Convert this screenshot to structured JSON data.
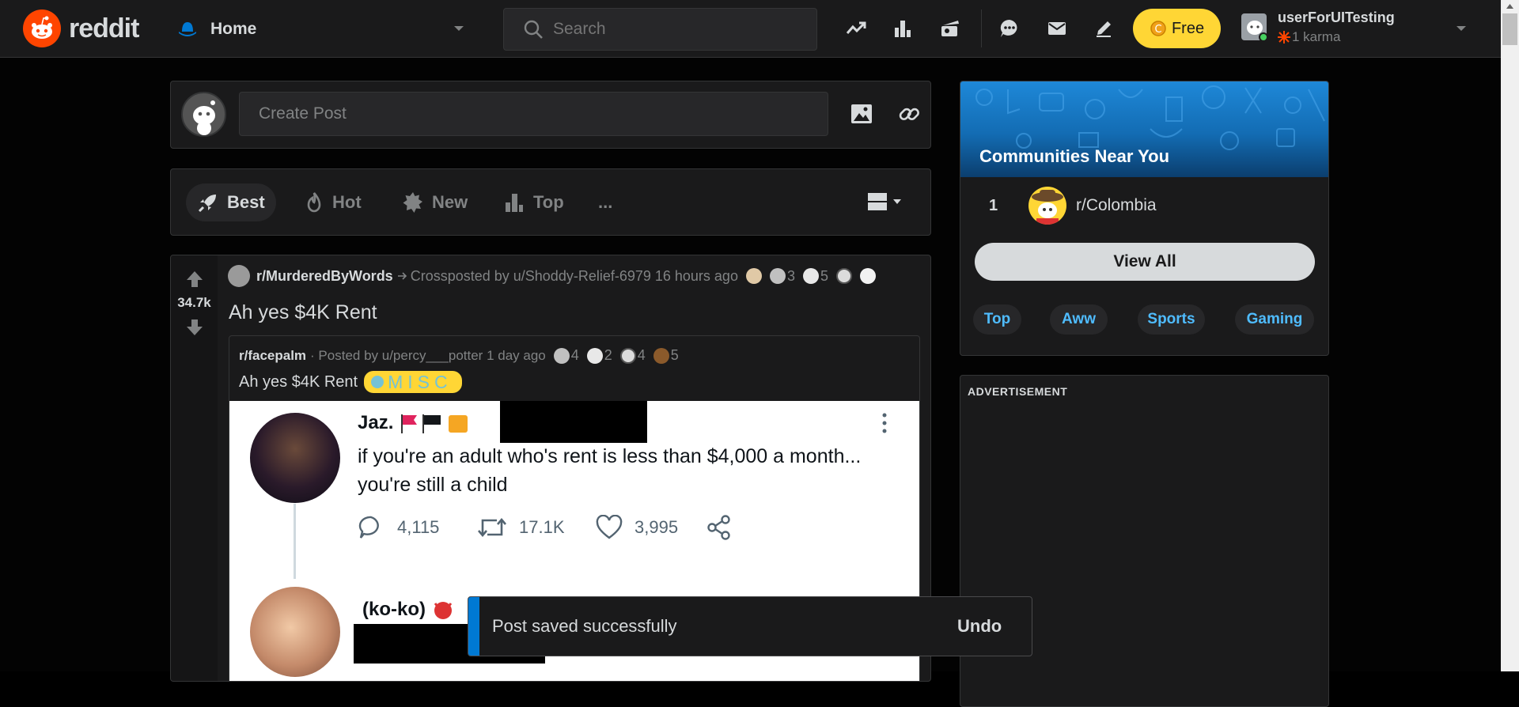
{
  "header": {
    "logo_text": "reddit",
    "home_label": "Home",
    "search_placeholder": "Search",
    "premium_label": "Free",
    "username": "userForUITesting",
    "karma": "1 karma"
  },
  "create_post": {
    "placeholder": "Create Post"
  },
  "sort": {
    "best": "Best",
    "hot": "Hot",
    "new": "New",
    "top": "Top",
    "more": "..."
  },
  "post": {
    "votes": "34.7k",
    "subreddit": "r/MurderedByWords",
    "crosspost_text": "Crossposted by u/Shoddy-Relief-6979 16 hours ago",
    "awards": [
      {
        "icon": "award-wink-icon",
        "count": ""
      },
      {
        "icon": "award-silver-icon",
        "count": "3"
      },
      {
        "icon": "award-face-icon",
        "count": "5"
      },
      {
        "icon": "award-s-icon",
        "count": ""
      },
      {
        "icon": "award-cat-icon",
        "count": ""
      }
    ],
    "title": "Ah yes $4K Rent",
    "inner": {
      "subreddit": "r/facepalm",
      "posted_text": "· Posted by u/percy___potter 1 day ago",
      "awards": [
        {
          "icon": "award-silver-icon",
          "count": "4"
        },
        {
          "icon": "award-face-icon",
          "count": "2"
        },
        {
          "icon": "award-s-icon",
          "count": "4"
        },
        {
          "icon": "award-poop-icon",
          "count": "5"
        }
      ],
      "title": "Ah yes $4K Rent",
      "flair": "MISC",
      "tweet": {
        "name": "Jaz.",
        "text": "if you're an adult who's rent is less than $4,000 a month... you're still a child",
        "replies": "4,115",
        "retweets": "17.1K",
        "likes": "3,995",
        "reply_name": "(ko-ko)"
      }
    }
  },
  "sidebar": {
    "communities_title": "Communities Near You",
    "rank": "1",
    "community": "r/Colombia",
    "view_all": "View All",
    "tags": [
      "Top",
      "Aww",
      "Sports",
      "Gaming"
    ],
    "ad_label": "ADVERTISEMENT"
  },
  "toast": {
    "message": "Post saved successfully",
    "undo": "Undo"
  },
  "colors": {
    "accent": "#ff4500",
    "blue": "#0079d3",
    "link": "#4fbcff",
    "premium": "#ffd635"
  }
}
